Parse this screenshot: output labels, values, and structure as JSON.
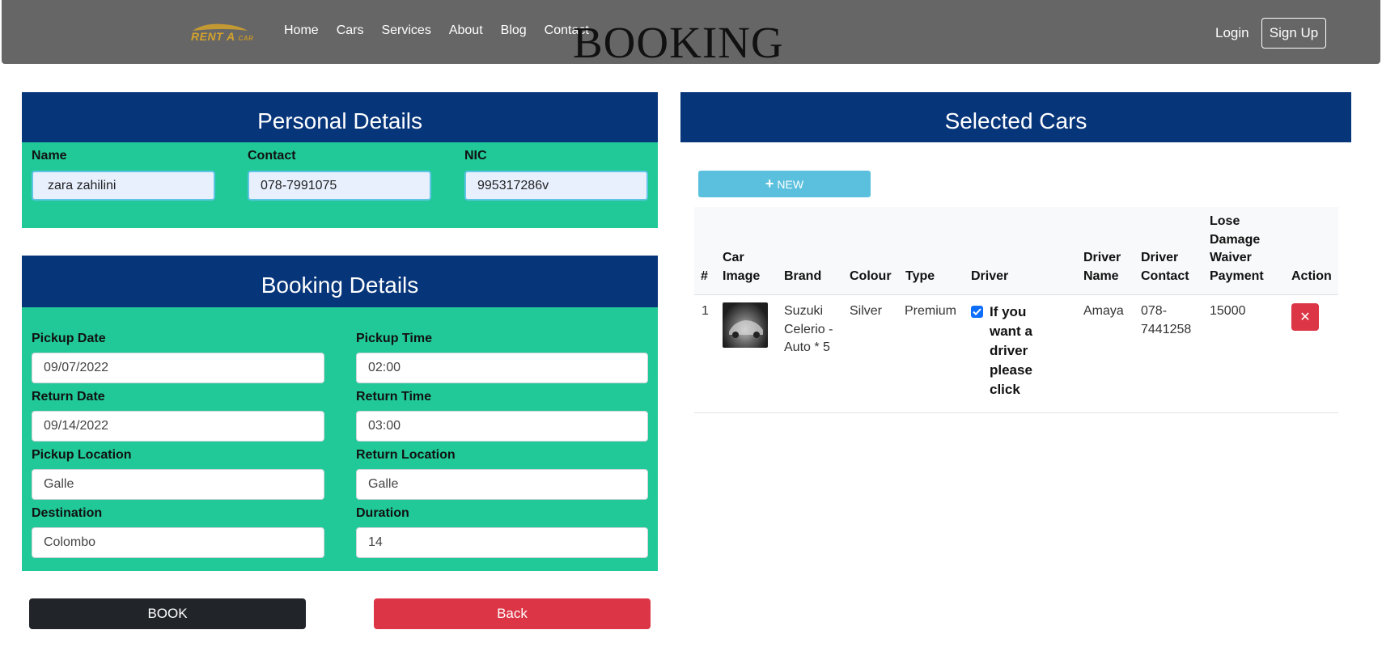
{
  "nav": {
    "logo_text": "RENT A",
    "logo_text_small": "CAR",
    "links": [
      "Home",
      "Cars",
      "Services",
      "About",
      "Blog",
      "Contact"
    ],
    "page_heading": "BOOKING",
    "login": "Login",
    "signup": "Sign Up"
  },
  "personal": {
    "title": "Personal Details",
    "name_label": "Name",
    "name_value": "zara zahilini",
    "contact_label": "Contact",
    "contact_value": "078-7991075",
    "nic_label": "NIC",
    "nic_value": "995317286v"
  },
  "booking": {
    "title": "Booking Details",
    "pickup_date_label": "Pickup Date",
    "pickup_date": "09/07/2022",
    "pickup_time_label": "Pickup Time",
    "pickup_time": "02:00",
    "return_date_label": "Return Date",
    "return_date": "09/14/2022",
    "return_time_label": "Return Time",
    "return_time": "03:00",
    "pickup_location_label": "Pickup Location",
    "pickup_location": "Galle",
    "return_location_label": "Return Location",
    "return_location": "Galle",
    "destination_label": "Destination",
    "destination": "Colombo",
    "duration_label": "Duration",
    "duration": "14"
  },
  "actions": {
    "book": "BOOK",
    "back": "Back"
  },
  "selected": {
    "title": "Selected Cars",
    "new_button": "NEW",
    "headers": {
      "index": "#",
      "car_image_1": "Car",
      "car_image_2": "Image",
      "brand": "Brand",
      "colour": "Colour",
      "type": "Type",
      "driver": "Driver",
      "driver_name_1": "Driver",
      "driver_name_2": "Name",
      "driver_contact_1": "Driver",
      "driver_contact_2": "Contact",
      "ldw_1": "Lose",
      "ldw_2": "Damage",
      "ldw_3": "Waiver",
      "ldw_4": "Payment",
      "action": "Action"
    },
    "row": {
      "index": "1",
      "brand_1": "Suzuki",
      "brand_2": "Celerio -",
      "brand_3": "Auto * 5",
      "colour": "Silver",
      "type": "Premium",
      "driver_checked": true,
      "driver_text_1": "If you",
      "driver_text_2": "want a",
      "driver_text_3": "driver",
      "driver_text_4": "please",
      "driver_text_5": "click",
      "driver_name": "Amaya",
      "driver_contact_1": "078-",
      "driver_contact_2": "7441258",
      "ldw_payment": "15000"
    }
  },
  "colors": {
    "navbar": "#666666",
    "panel_header": "#07357a",
    "panel_body": "#20c997",
    "info_button": "#5bc0de",
    "danger": "#dc3545",
    "dark": "#212529",
    "logo_gold": "#d4a22c"
  }
}
